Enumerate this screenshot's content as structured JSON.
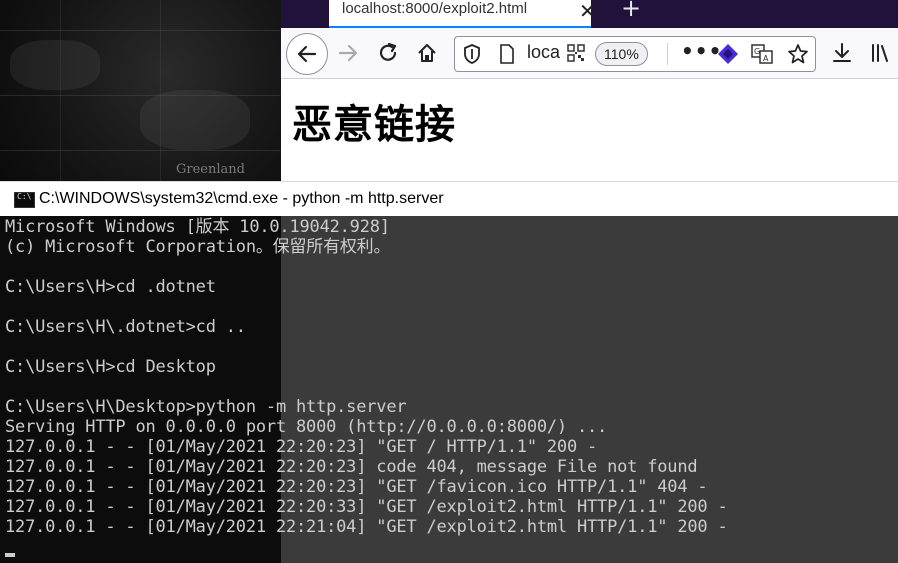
{
  "desktop": {
    "map_label": "Greenland"
  },
  "browser": {
    "tab_title": "localhost:8000/exploit2.html",
    "url_display": "loca",
    "zoom": "110%",
    "page_heading": "恶意链接"
  },
  "cmd": {
    "title": "C:\\WINDOWS\\system32\\cmd.exe - python  -m http.server",
    "lines": [
      "Microsoft Windows [版本 10.0.19042.928]",
      "(c) Microsoft Corporation。保留所有权利。",
      "",
      "C:\\Users\\H>cd .dotnet",
      "",
      "C:\\Users\\H\\.dotnet>cd ..",
      "",
      "C:\\Users\\H>cd Desktop",
      "",
      "C:\\Users\\H\\Desktop>python -m http.server",
      "Serving HTTP on 0.0.0.0 port 8000 (http://0.0.0.0:8000/) ...",
      "127.0.0.1 - - [01/May/2021 22:20:23] \"GET / HTTP/1.1\" 200 -",
      "127.0.0.1 - - [01/May/2021 22:20:23] code 404, message File not found",
      "127.0.0.1 - - [01/May/2021 22:20:23] \"GET /favicon.ico HTTP/1.1\" 404 -",
      "127.0.0.1 - - [01/May/2021 22:20:33] \"GET /exploit2.html HTTP/1.1\" 200 -",
      "127.0.0.1 - - [01/May/2021 22:21:04] \"GET /exploit2.html HTTP/1.1\" 200 -"
    ]
  },
  "colors": {
    "firefox_tabstrip": "#20123a",
    "console_fg": "#cccccc",
    "console_bg": "#0c0c0c"
  }
}
